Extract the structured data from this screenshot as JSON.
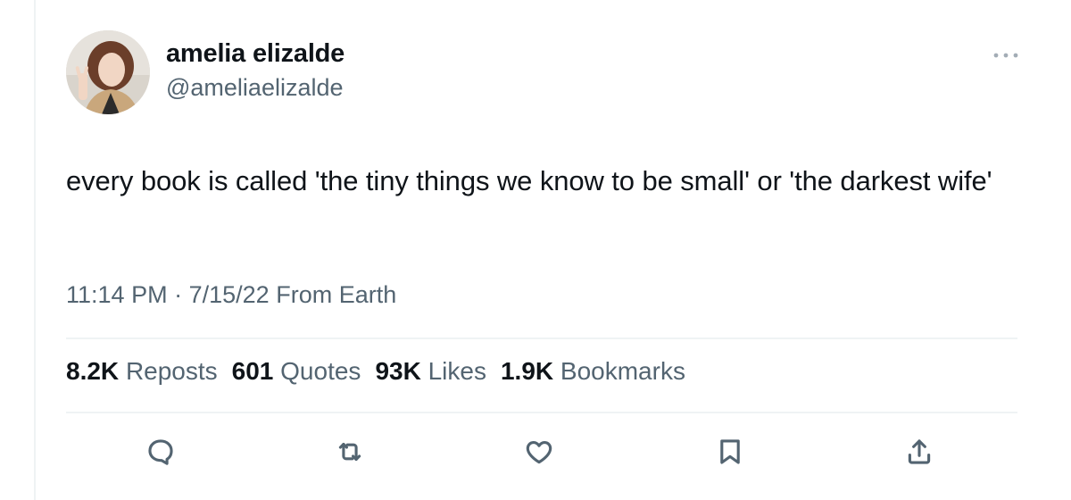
{
  "author": {
    "display_name": "amelia elizalde",
    "handle": "@ameliaelizalde"
  },
  "tweet": {
    "text": "every book is called 'the tiny things we know to be small' or 'the darkest wife'",
    "time": "11:14 PM",
    "separator": "·",
    "date": "7/15/22",
    "source": "From Earth"
  },
  "stats": [
    {
      "count": "8.2K",
      "label": "Reposts"
    },
    {
      "count": "601",
      "label": "Quotes"
    },
    {
      "count": "93K",
      "label": "Likes"
    },
    {
      "count": "1.9K",
      "label": "Bookmarks"
    }
  ],
  "actions": [
    {
      "icon": "reply-icon"
    },
    {
      "icon": "repost-icon"
    },
    {
      "icon": "like-icon"
    },
    {
      "icon": "bookmark-icon"
    },
    {
      "icon": "share-icon"
    }
  ],
  "colors": {
    "text_primary": "#0f1419",
    "text_secondary": "#536471",
    "divider": "#eff3f4"
  }
}
